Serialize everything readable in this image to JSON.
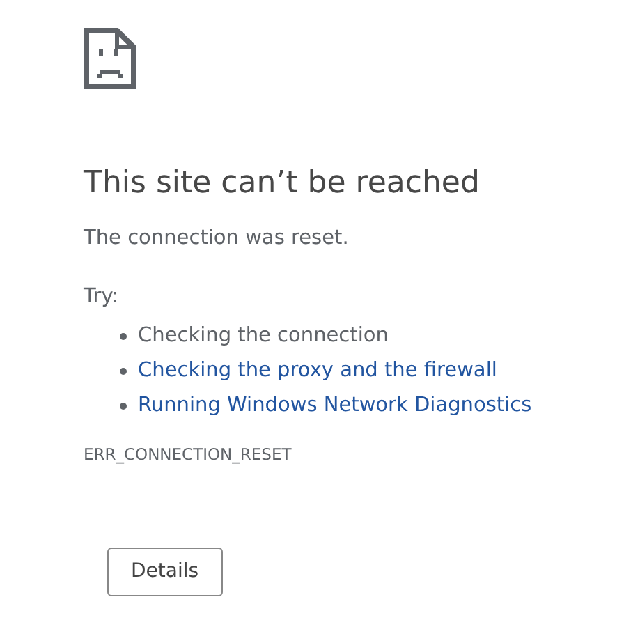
{
  "title": "This site can’t be reached",
  "message": "The connection was reset.",
  "try_label": "Try:",
  "suggestions": [
    {
      "kind": "text",
      "text": "Checking the connection"
    },
    {
      "kind": "link",
      "text": "Checking the proxy and the firewall"
    },
    {
      "kind": "link",
      "text": "Running Windows Network Diagnostics"
    }
  ],
  "error_code": "ERR_CONNECTION_RESET",
  "buttons": [
    "Details"
  ]
}
